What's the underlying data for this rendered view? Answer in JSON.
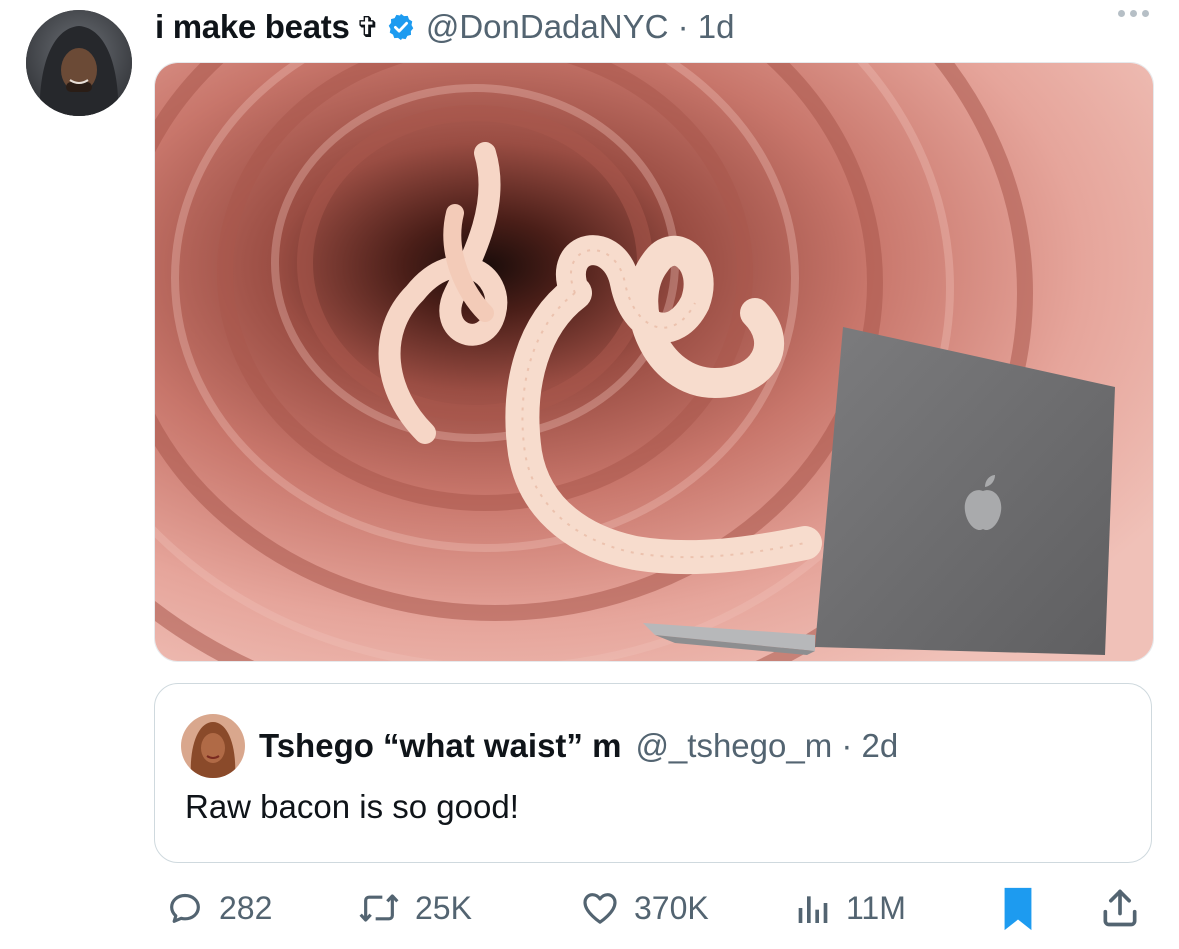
{
  "author": {
    "display_name": "i make beats",
    "name_emoji": "✞",
    "handle": "@DonDadaNYC",
    "time": "1d",
    "verified": true
  },
  "media": {
    "description_icon": "image"
  },
  "quoted": {
    "display_name": "Tshego “what waist” m",
    "handle": "@_tshego_m",
    "time": "2d",
    "text": "Raw bacon is so good!"
  },
  "actions": {
    "replies": "282",
    "reposts": "25K",
    "likes": "370K",
    "views": "11M"
  },
  "colors": {
    "verified": "#1d9bf0",
    "bookmark": "#1d9bf0",
    "secondary_text": "#536471"
  }
}
